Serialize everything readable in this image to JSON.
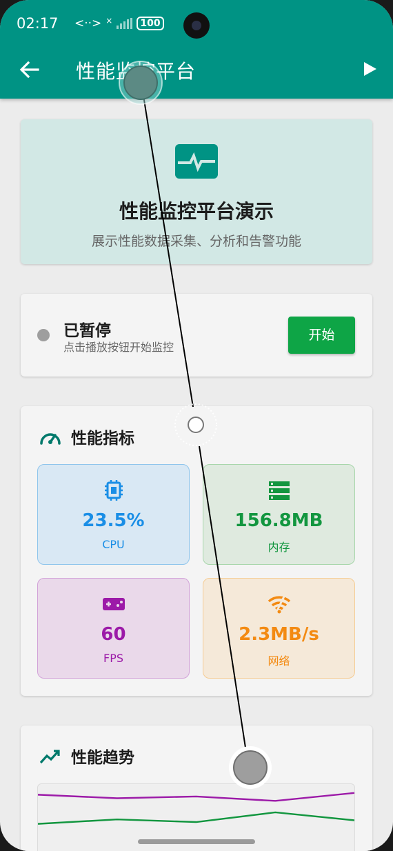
{
  "status_bar": {
    "time": "02:17",
    "network": "<··>",
    "signal_x": "×",
    "battery": "100"
  },
  "app_bar": {
    "title": "性能监控平台"
  },
  "hero": {
    "title": "性能监控平台演示",
    "subtitle": "展示性能数据采集、分析和告警功能"
  },
  "status": {
    "state": "已暂停",
    "hint": "点击播放按钮开始监控",
    "start_label": "开始"
  },
  "metrics": {
    "section_title": "性能指标",
    "tiles": [
      {
        "value": "23.5%",
        "label": "CPU",
        "icon": "cpu-chip-icon",
        "color": "#1a8ee6"
      },
      {
        "value": "156.8MB",
        "label": "内存",
        "icon": "memory-icon",
        "color": "#12963f"
      },
      {
        "value": "60",
        "label": "FPS",
        "icon": "gamepad-icon",
        "color": "#9c1aa8"
      },
      {
        "value": "2.3MB/s",
        "label": "网络",
        "icon": "network-signal-icon",
        "color": "#f38a12"
      }
    ]
  },
  "trend": {
    "section_title": "性能趋势",
    "series": [
      {
        "color": "#9c1aa8",
        "values": [
          0.88,
          0.84,
          0.86,
          0.81,
          0.9
        ]
      },
      {
        "color": "#12963f",
        "values": [
          0.55,
          0.6,
          0.57,
          0.68,
          0.59
        ]
      }
    ]
  },
  "colors": {
    "primary": "#009384",
    "accent_green": "#0ea546"
  }
}
